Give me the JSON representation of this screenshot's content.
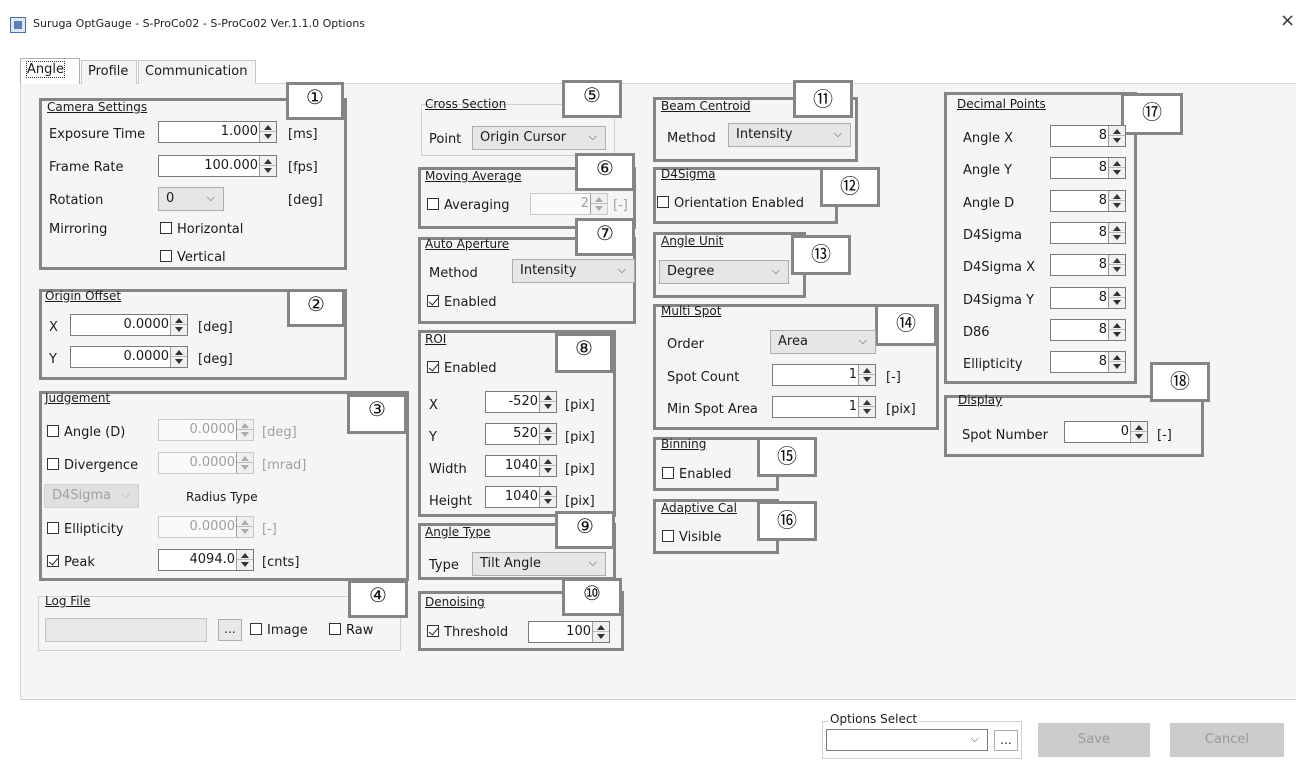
{
  "window": {
    "title": "Suruga OptGauge - S-ProCo02 - S-ProCo02 Ver.1.1.0 Options",
    "close_icon": "×"
  },
  "tabs": [
    {
      "label": "Angle"
    },
    {
      "label": "Profile"
    },
    {
      "label": "Communication"
    }
  ],
  "camera_settings": {
    "title": "Camera Settings",
    "marker": "①",
    "exposure_label": "Exposure Time",
    "exposure_value": "1.000",
    "exposure_unit": "[ms]",
    "frame_rate_label": "Frame Rate",
    "frame_rate_value": "100.000",
    "frame_rate_unit": "[fps]",
    "rotation_label": "Rotation",
    "rotation_value": "0",
    "rotation_unit": "[deg]",
    "mirroring_label": "Mirroring",
    "horizontal_label": "Horizontal",
    "vertical_label": "Vertical"
  },
  "origin_offset": {
    "title": "Origin Offset",
    "marker": "②",
    "x_label": "X",
    "x_value": "0.0000",
    "y_label": "Y",
    "y_value": "0.0000",
    "unit": "[deg]"
  },
  "judgement": {
    "title": "Judgement",
    "marker": "③",
    "angle_label": "Angle (D)",
    "angle_value": "0.0000",
    "angle_unit": "[deg]",
    "divergence_label": "Divergence",
    "divergence_value": "0.0000",
    "divergence_unit": "[mrad]",
    "radius_combo": "D4Sigma",
    "radius_type_label": "Radius Type",
    "ellipticity_label": "Ellipticity",
    "ellipticity_value": "0.0000",
    "ellipticity_unit": "[-]",
    "peak_label": "Peak",
    "peak_value": "4094.0",
    "peak_unit": "[cnts]"
  },
  "log_file": {
    "title": "Log File",
    "marker": "④",
    "browse": "...",
    "image_label": "Image",
    "raw_label": "Raw"
  },
  "cross_section": {
    "title": "Cross Section",
    "marker": "⑤",
    "point_label": "Point",
    "point_value": "Origin Cursor"
  },
  "moving_average": {
    "title": "Moving Average",
    "marker": "⑥",
    "averaging_label": "Averaging",
    "value": "2",
    "unit": "[-]"
  },
  "auto_aperture": {
    "title": "Auto Aperture",
    "marker": "⑦",
    "method_label": "Method",
    "method_value": "Intensity",
    "enabled_label": "Enabled"
  },
  "roi": {
    "title": "ROI",
    "marker": "⑧",
    "enabled_label": "Enabled",
    "x_label": "X",
    "x_value": "-520",
    "y_label": "Y",
    "y_value": "520",
    "width_label": "Width",
    "width_value": "1040",
    "height_label": "Height",
    "height_value": "1040",
    "unit": "[pix]"
  },
  "angle_type": {
    "title": "Angle Type",
    "marker": "⑨",
    "type_label": "Type",
    "type_value": "Tilt Angle"
  },
  "denoising": {
    "title": "Denoising",
    "marker": "⑩",
    "threshold_label": "Threshold",
    "threshold_value": "100"
  },
  "beam_centroid": {
    "title": "Beam Centroid",
    "marker": "⑪",
    "method_label": "Method",
    "method_value": "Intensity"
  },
  "d4sigma": {
    "title": "D4Sigma",
    "marker": "⑫",
    "orientation_label": "Orientation Enabled"
  },
  "angle_unit": {
    "title": "Angle Unit",
    "marker": "⑬",
    "value": "Degree"
  },
  "multi_spot": {
    "title": "Multi Spot",
    "marker": "⑭",
    "order_label": "Order",
    "order_value": "Area",
    "spot_count_label": "Spot Count",
    "spot_count_value": "1",
    "spot_count_unit": "[-]",
    "min_area_label": "Min Spot Area",
    "min_area_value": "1",
    "min_area_unit": "[pix]"
  },
  "binning": {
    "title": "Binning",
    "marker": "⑮",
    "enabled_label": "Enabled"
  },
  "adaptive_cal": {
    "title": "Adaptive Cal",
    "marker": "⑯",
    "visible_label": "Visible"
  },
  "decimal_points": {
    "title": "Decimal Points",
    "marker": "⑰",
    "rows": [
      {
        "label": "Angle X",
        "value": "8"
      },
      {
        "label": "Angle Y",
        "value": "8"
      },
      {
        "label": "Angle D",
        "value": "8"
      },
      {
        "label": "D4Sigma",
        "value": "8"
      },
      {
        "label": "D4Sigma X",
        "value": "8"
      },
      {
        "label": "D4Sigma Y",
        "value": "8"
      },
      {
        "label": "D86",
        "value": "8"
      },
      {
        "label": "Ellipticity",
        "value": "8"
      }
    ]
  },
  "display": {
    "title": "Display",
    "marker": "⑱",
    "spot_number_label": "Spot Number",
    "spot_number_value": "0",
    "unit": "[-]"
  },
  "footer": {
    "options_select_label": "Options Select",
    "browse": "...",
    "save": "Save",
    "cancel": "Cancel"
  }
}
